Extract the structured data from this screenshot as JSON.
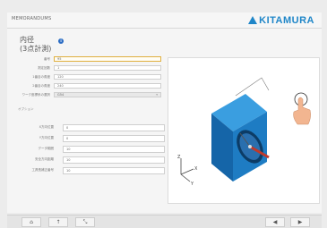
{
  "header": {
    "app_title": "MEMORANDUMS",
    "brand": "KITAMURA"
  },
  "page": {
    "title_line1": "内径",
    "title_line2": "(3点計測)"
  },
  "form": {
    "fields": [
      {
        "label": "番号",
        "value": "95"
      },
      {
        "label": "測定回数",
        "value": "1"
      },
      {
        "label": "1番目の角度",
        "value": "120"
      },
      {
        "label": "2番目の角度",
        "value": "240"
      },
      {
        "label": "ワーク座標系の選択",
        "value": "G54"
      }
    ],
    "section_label": "オプション",
    "options": [
      {
        "label": "X方向位置",
        "value": "0"
      },
      {
        "label": "Y方向位置",
        "value": "0"
      },
      {
        "label": "データ範囲",
        "value": "10"
      },
      {
        "label": "安全方向距離",
        "value": "10"
      },
      {
        "label": "工具長補正番号",
        "value": "10"
      }
    ]
  },
  "illustration": {
    "axis_z": "Z",
    "axis_y": "Y",
    "axis_x": "X"
  },
  "footer": {
    "home_icon": "home-icon",
    "upload_icon": "arrow-up-icon",
    "expand_icon": "expand-icon",
    "prev_icon": "back-icon",
    "next_icon": "next-icon"
  },
  "colors": {
    "brand": "#1f86c8",
    "block": "#1e7cc3",
    "probe": "#c0392b"
  }
}
